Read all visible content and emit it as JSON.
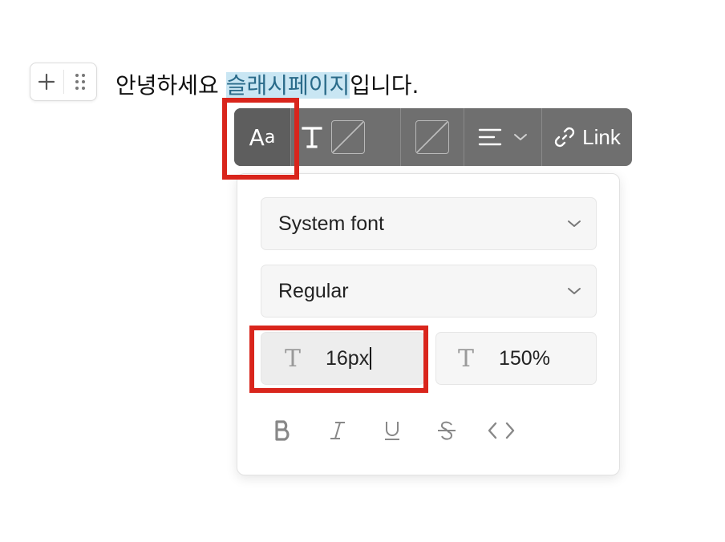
{
  "block_handle": {
    "add_icon": "plus-icon",
    "drag_icon": "drag-dots-icon"
  },
  "paragraph": {
    "before": "안녕하세요 ",
    "selected": "슬래시페이지",
    "after": "입니다."
  },
  "toolbar": {
    "font_button_big": "A",
    "font_button_small": "a",
    "text_color_glyph": "T",
    "link_label": "Link",
    "icons": {
      "text_color": "text-color-icon",
      "no_color": "no-color-swatch-icon",
      "align": "align-left-icon",
      "chevron": "chevron-down-icon",
      "link": "link-icon"
    }
  },
  "popover": {
    "font_family": "System font",
    "font_weight": "Regular",
    "font_size_icon": "T",
    "font_size": "16px",
    "line_height_icon": "T",
    "line_height": "150%",
    "format_icons": [
      "bold-icon",
      "italic-icon",
      "underline-icon",
      "strikethrough-icon",
      "code-icon"
    ]
  },
  "colors": {
    "toolbar_bg": "#6f6f6f",
    "selection_bg": "#c9e6f3",
    "annotation": "#d9251c"
  }
}
